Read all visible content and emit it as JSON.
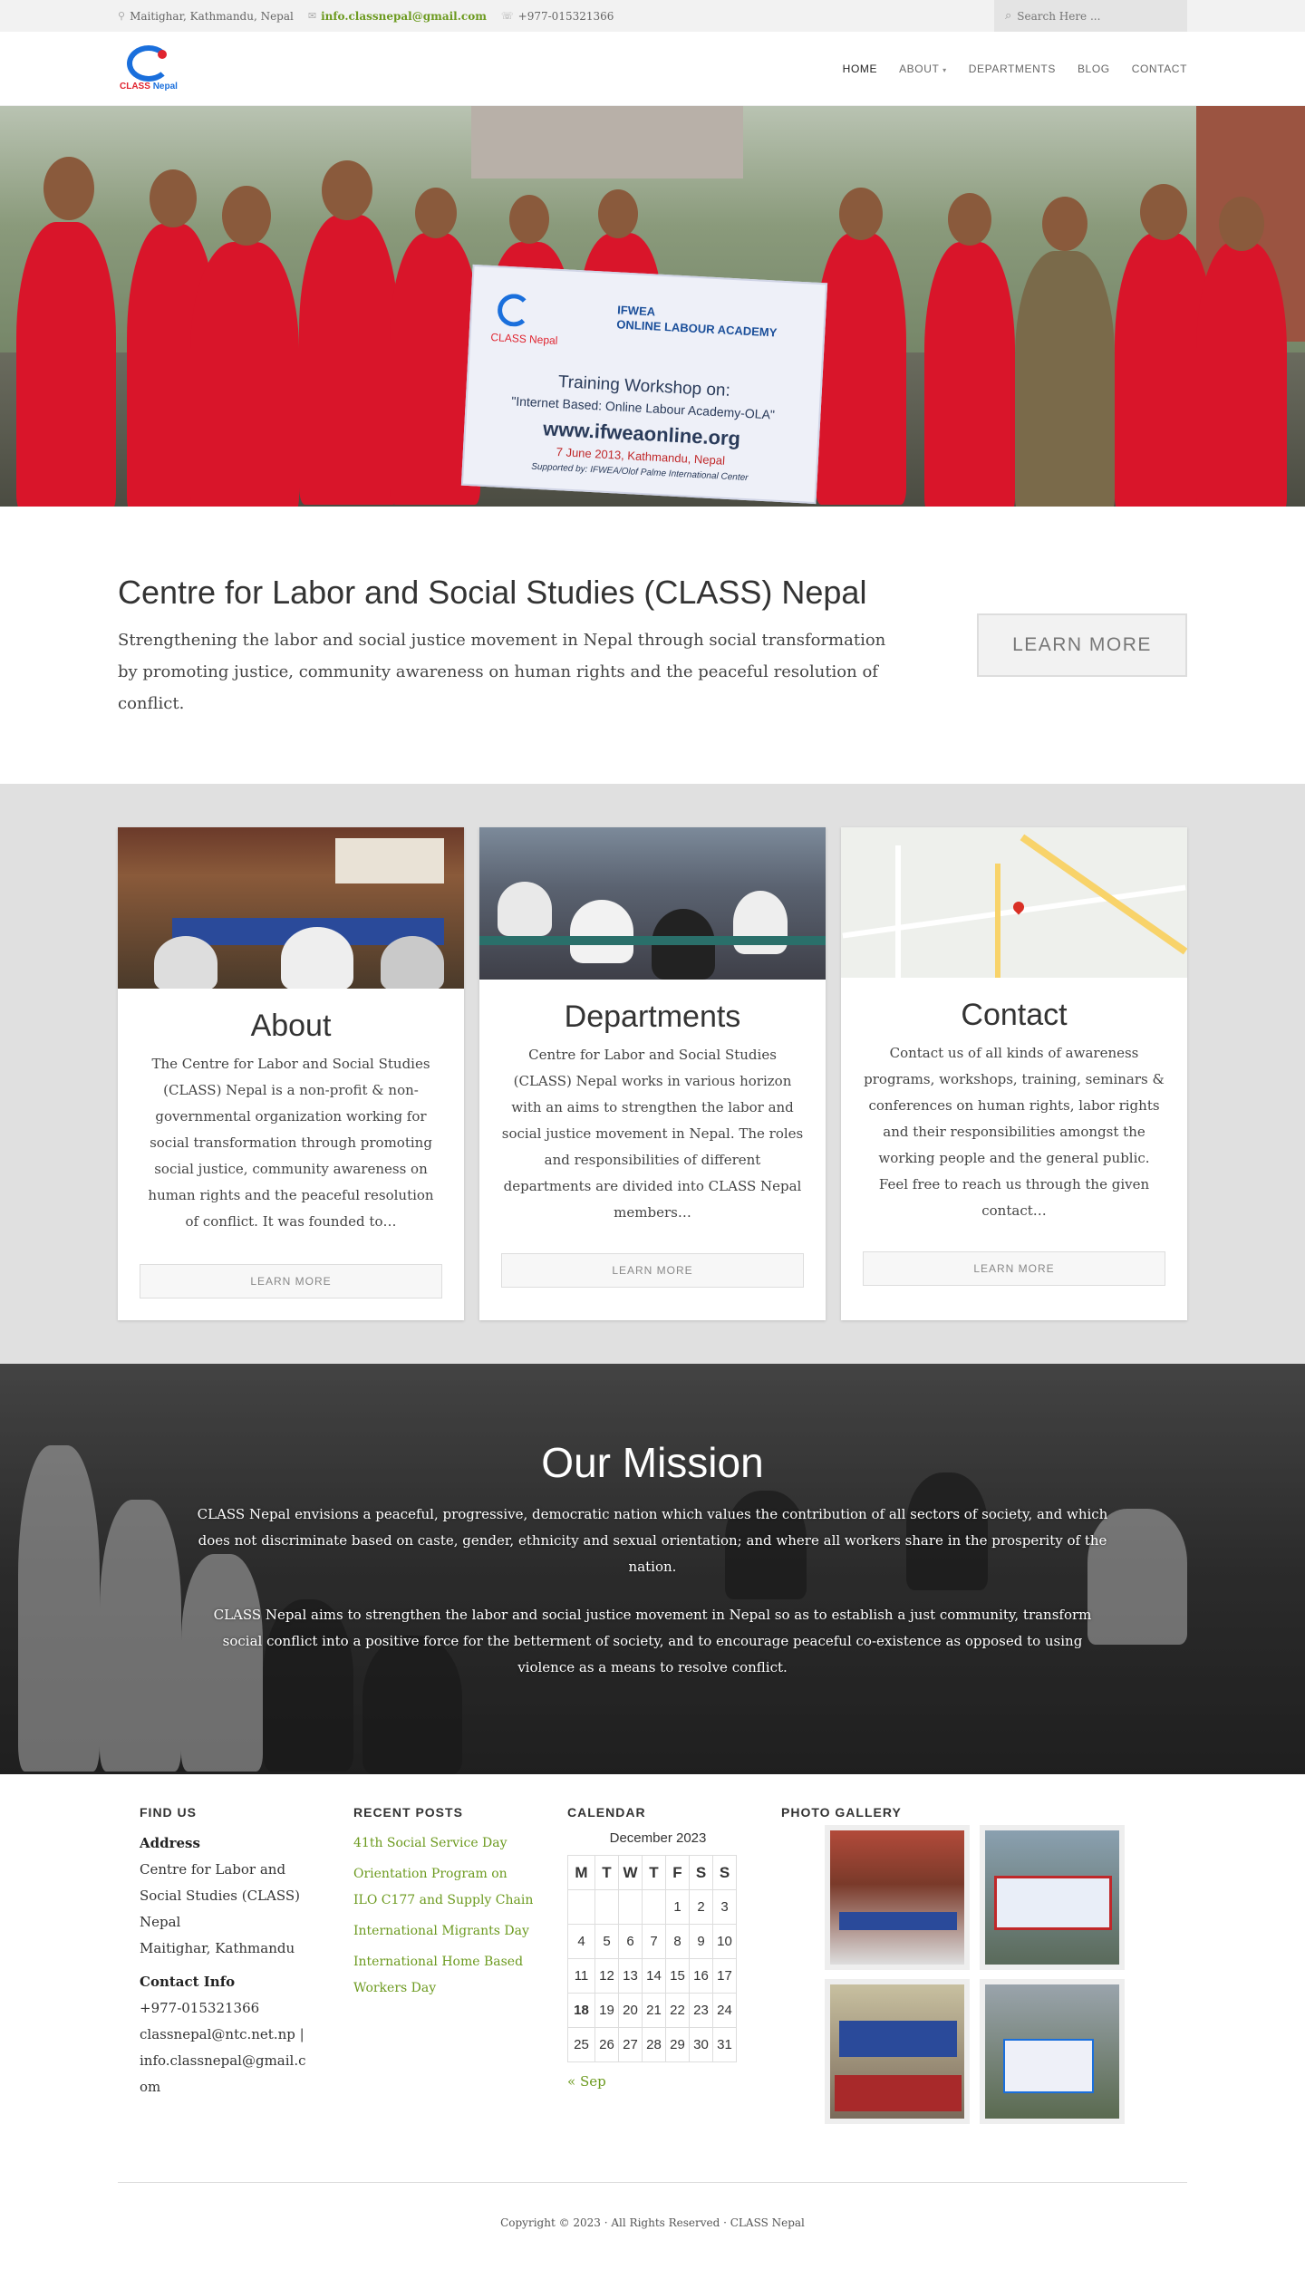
{
  "topbar": {
    "address": "Maitighar, Kathmandu, Nepal",
    "email": "info.classnepal@gmail.com",
    "phone": "+977-015321366",
    "search_placeholder": "Search Here ...",
    "icons": [
      "location-icon",
      "envelope-icon",
      "phone-icon",
      "search-icon"
    ]
  },
  "logo": {
    "text_a": "CLASS",
    "text_b": "Nepal"
  },
  "nav": {
    "items": [
      {
        "label": "HOME"
      },
      {
        "label": "ABOUT"
      },
      {
        "label": "DEPARTMENTS"
      },
      {
        "label": "BLOG"
      },
      {
        "label": "CONTACT"
      }
    ],
    "about_caret": "▾"
  },
  "hero": {
    "banner_logo_label": "CLASS Nepal",
    "banner_org_line1": "IFWEA",
    "banner_org_line2": "ONLINE LABOUR ACADEMY",
    "banner_title": "Training Workshop on:",
    "banner_subtitle": "\"Internet Based: Online Labour Academy-OLA\"",
    "banner_url": "www.ifweaonline.org",
    "banner_date": "7 June 2013,  Kathmandu, Nepal",
    "banner_support": "Supported by: IFWEA/Olof Palme International Center"
  },
  "intro": {
    "title": "Centre for Labor and Social Studies (CLASS) Nepal",
    "text": "Strengthening the labor and social justice movement in Nepal through social transformation by promoting justice, community awareness on human rights and the peaceful resolution of conflict.",
    "button": "LEARN MORE"
  },
  "cards": [
    {
      "title": "About",
      "text": "The Centre for Labor and Social Studies (CLASS) Nepal is a non-profit & non-governmental organization working for social transformation through promoting social justice, community awareness on human rights and the peaceful resolution of conflict. It was founded to…",
      "button": "LEARN MORE"
    },
    {
      "title": "Departments",
      "text": "Centre for Labor and Social Studies (CLASS) Nepal works in various horizon with an aims to strengthen the labor and social justice movement in Nepal. The roles and responsibilities of different departments are divided into CLASS Nepal members…",
      "button": "LEARN MORE"
    },
    {
      "title": "Contact",
      "text": "Contact us of all kinds of awareness programs, workshops, training, seminars & conferences on human rights, labor rights and their responsibilities amongst the working people and the general public. Feel free to reach us through the given contact…",
      "button": "LEARN MORE"
    }
  ],
  "mission": {
    "title": "Our Mission",
    "p1": "CLASS Nepal envisions a peaceful, progressive, democratic nation which values the contribution of all sectors of society, and which does not discriminate based on caste, gender, ethnicity and sexual orientation; and where all workers share in the prosperity of the nation.",
    "p2": "CLASS Nepal aims to strengthen the labor and social justice movement in Nepal so as to establish a just community, transform social conflict into a positive force for the betterment of society, and to encourage peaceful co-existence as opposed to using violence as a means to resolve conflict."
  },
  "footer": {
    "findus": {
      "heading": "FIND US",
      "address_label": "Address",
      "address_lines": [
        "Centre for Labor and",
        "Social Studies (CLASS)",
        "Nepal",
        "Maitighar, Kathmandu"
      ],
      "contact_label": "Contact Info",
      "contact_lines": [
        "+977-015321366",
        "classnepal@ntc.net.np |",
        "info.classnepal@gmail.c",
        "om"
      ]
    },
    "posts": {
      "heading": "RECENT POSTS",
      "items": [
        "41th Social Service Day",
        "Orientation Program on ILO C177 and Supply Chain",
        "International Migrants Day",
        "International Home Based Workers Day"
      ]
    },
    "calendar": {
      "heading": "CALENDAR",
      "month": "December 2023",
      "days": [
        "M",
        "T",
        "W",
        "T",
        "F",
        "S",
        "S"
      ],
      "weeks": [
        [
          "",
          "",
          "",
          "",
          "1",
          "2",
          "3"
        ],
        [
          "4",
          "5",
          "6",
          "7",
          "8",
          "9",
          "10"
        ],
        [
          "11",
          "12",
          "13",
          "14",
          "15",
          "16",
          "17"
        ],
        [
          "18",
          "19",
          "20",
          "21",
          "22",
          "23",
          "24"
        ],
        [
          "25",
          "26",
          "27",
          "28",
          "29",
          "30",
          "31"
        ]
      ],
      "today": "18",
      "prev": "« Sep"
    },
    "gallery": {
      "heading": "PHOTO GALLERY"
    }
  },
  "copyright": "Copyright © 2023 · All Rights Reserved · CLASS Nepal",
  "colors": {
    "link_green": "#6c9a1f",
    "brand_blue": "#1a6fdc",
    "brand_red": "#e0242f",
    "shirt_red": "#d9152a"
  }
}
